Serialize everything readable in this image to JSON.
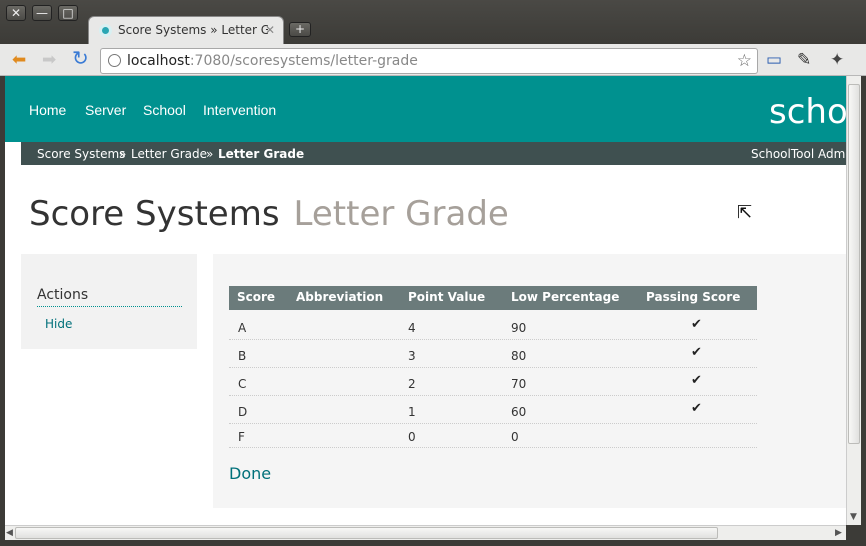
{
  "window": {
    "close_glyph": "✕",
    "minimize_glyph": "—",
    "maximize_glyph": "□"
  },
  "tab": {
    "title": "Score Systems » Letter Gr",
    "close_glyph": "✕",
    "new_tab_glyph": "+"
  },
  "toolbar": {
    "back_glyph": "⬅",
    "forward_glyph": "➡",
    "reload_glyph": "↻",
    "url_host": "localhost",
    "url_rest": ":7080/scoresystems/letter-grade",
    "star_glyph": "☆",
    "page_glyph": "▭",
    "pin_glyph": "✎",
    "wrench_glyph": "✦"
  },
  "nav": {
    "items": [
      "Home",
      "Server",
      "School",
      "Intervention"
    ],
    "brand": "scho"
  },
  "breadcrumb": {
    "items": [
      "Score Systems",
      "Letter Grade"
    ],
    "separator": "»",
    "current": "Letter Grade",
    "user": "SchoolTool Admin"
  },
  "page": {
    "title": "Score Systems",
    "subtitle": "Letter Grade"
  },
  "sidebar": {
    "heading": "Actions",
    "hide_label": "Hide"
  },
  "table": {
    "headers": [
      "Score",
      "Abbreviation",
      "Point Value",
      "Low Percentage",
      "Passing Score"
    ],
    "rows": [
      {
        "score": "A",
        "abbreviation": "",
        "point_value": "4",
        "low_percentage": "90",
        "passing": true
      },
      {
        "score": "B",
        "abbreviation": "",
        "point_value": "3",
        "low_percentage": "80",
        "passing": true
      },
      {
        "score": "C",
        "abbreviation": "",
        "point_value": "2",
        "low_percentage": "70",
        "passing": true
      },
      {
        "score": "D",
        "abbreviation": "",
        "point_value": "1",
        "low_percentage": "60",
        "passing": true
      },
      {
        "score": "F",
        "abbreviation": "",
        "point_value": "0",
        "low_percentage": "0",
        "passing": false
      }
    ],
    "check_glyph": "✔"
  },
  "done_label": "Done",
  "colors": {
    "header_bg": "#00918f",
    "breadcrumb_bg": "#3f5050",
    "table_header_bg": "#6b7b7b",
    "link": "#00707a"
  }
}
